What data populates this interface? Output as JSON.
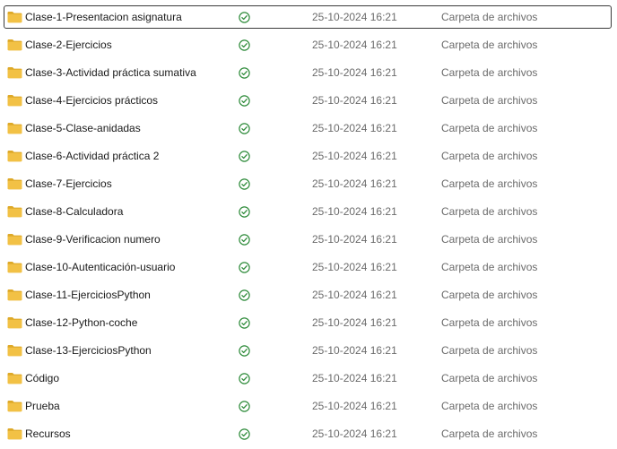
{
  "colors": {
    "folder": "#f2c145",
    "folder_dark": "#dea928",
    "sync_ok": "#2e8b3a",
    "text": "#1a1a1a",
    "muted": "#6b6b6b"
  },
  "icons": {
    "folder": "folder-icon",
    "status": "check-circle-icon"
  },
  "files": [
    {
      "name": "Clase-1-Presentacion asignatura",
      "status": "synced",
      "date": "25-10-2024 16:21",
      "type": "Carpeta de archivos",
      "selected": true
    },
    {
      "name": "Clase-2-Ejercicios",
      "status": "synced",
      "date": "25-10-2024 16:21",
      "type": "Carpeta de archivos",
      "selected": false
    },
    {
      "name": "Clase-3-Actividad práctica sumativa",
      "status": "synced",
      "date": "25-10-2024 16:21",
      "type": "Carpeta de archivos",
      "selected": false
    },
    {
      "name": "Clase-4-Ejercicios prácticos",
      "status": "synced",
      "date": "25-10-2024 16:21",
      "type": "Carpeta de archivos",
      "selected": false
    },
    {
      "name": "Clase-5-Clase-anidadas",
      "status": "synced",
      "date": "25-10-2024 16:21",
      "type": "Carpeta de archivos",
      "selected": false
    },
    {
      "name": "Clase-6-Actividad práctica 2",
      "status": "synced",
      "date": "25-10-2024 16:21",
      "type": "Carpeta de archivos",
      "selected": false
    },
    {
      "name": "Clase-7-Ejercicios",
      "status": "synced",
      "date": "25-10-2024 16:21",
      "type": "Carpeta de archivos",
      "selected": false
    },
    {
      "name": "Clase-8-Calculadora",
      "status": "synced",
      "date": "25-10-2024 16:21",
      "type": "Carpeta de archivos",
      "selected": false
    },
    {
      "name": "Clase-9-Verificacion numero",
      "status": "synced",
      "date": "25-10-2024 16:21",
      "type": "Carpeta de archivos",
      "selected": false
    },
    {
      "name": "Clase-10-Autenticación-usuario",
      "status": "synced",
      "date": "25-10-2024 16:21",
      "type": "Carpeta de archivos",
      "selected": false
    },
    {
      "name": "Clase-11-EjerciciosPython",
      "status": "synced",
      "date": "25-10-2024 16:21",
      "type": "Carpeta de archivos",
      "selected": false
    },
    {
      "name": "Clase-12-Python-coche",
      "status": "synced",
      "date": "25-10-2024 16:21",
      "type": "Carpeta de archivos",
      "selected": false
    },
    {
      "name": "Clase-13-EjerciciosPython",
      "status": "synced",
      "date": "25-10-2024 16:21",
      "type": "Carpeta de archivos",
      "selected": false
    },
    {
      "name": "Código",
      "status": "synced",
      "date": "25-10-2024 16:21",
      "type": "Carpeta de archivos",
      "selected": false
    },
    {
      "name": "Prueba",
      "status": "synced",
      "date": "25-10-2024 16:21",
      "type": "Carpeta de archivos",
      "selected": false
    },
    {
      "name": "Recursos",
      "status": "synced",
      "date": "25-10-2024 16:21",
      "type": "Carpeta de archivos",
      "selected": false
    }
  ]
}
